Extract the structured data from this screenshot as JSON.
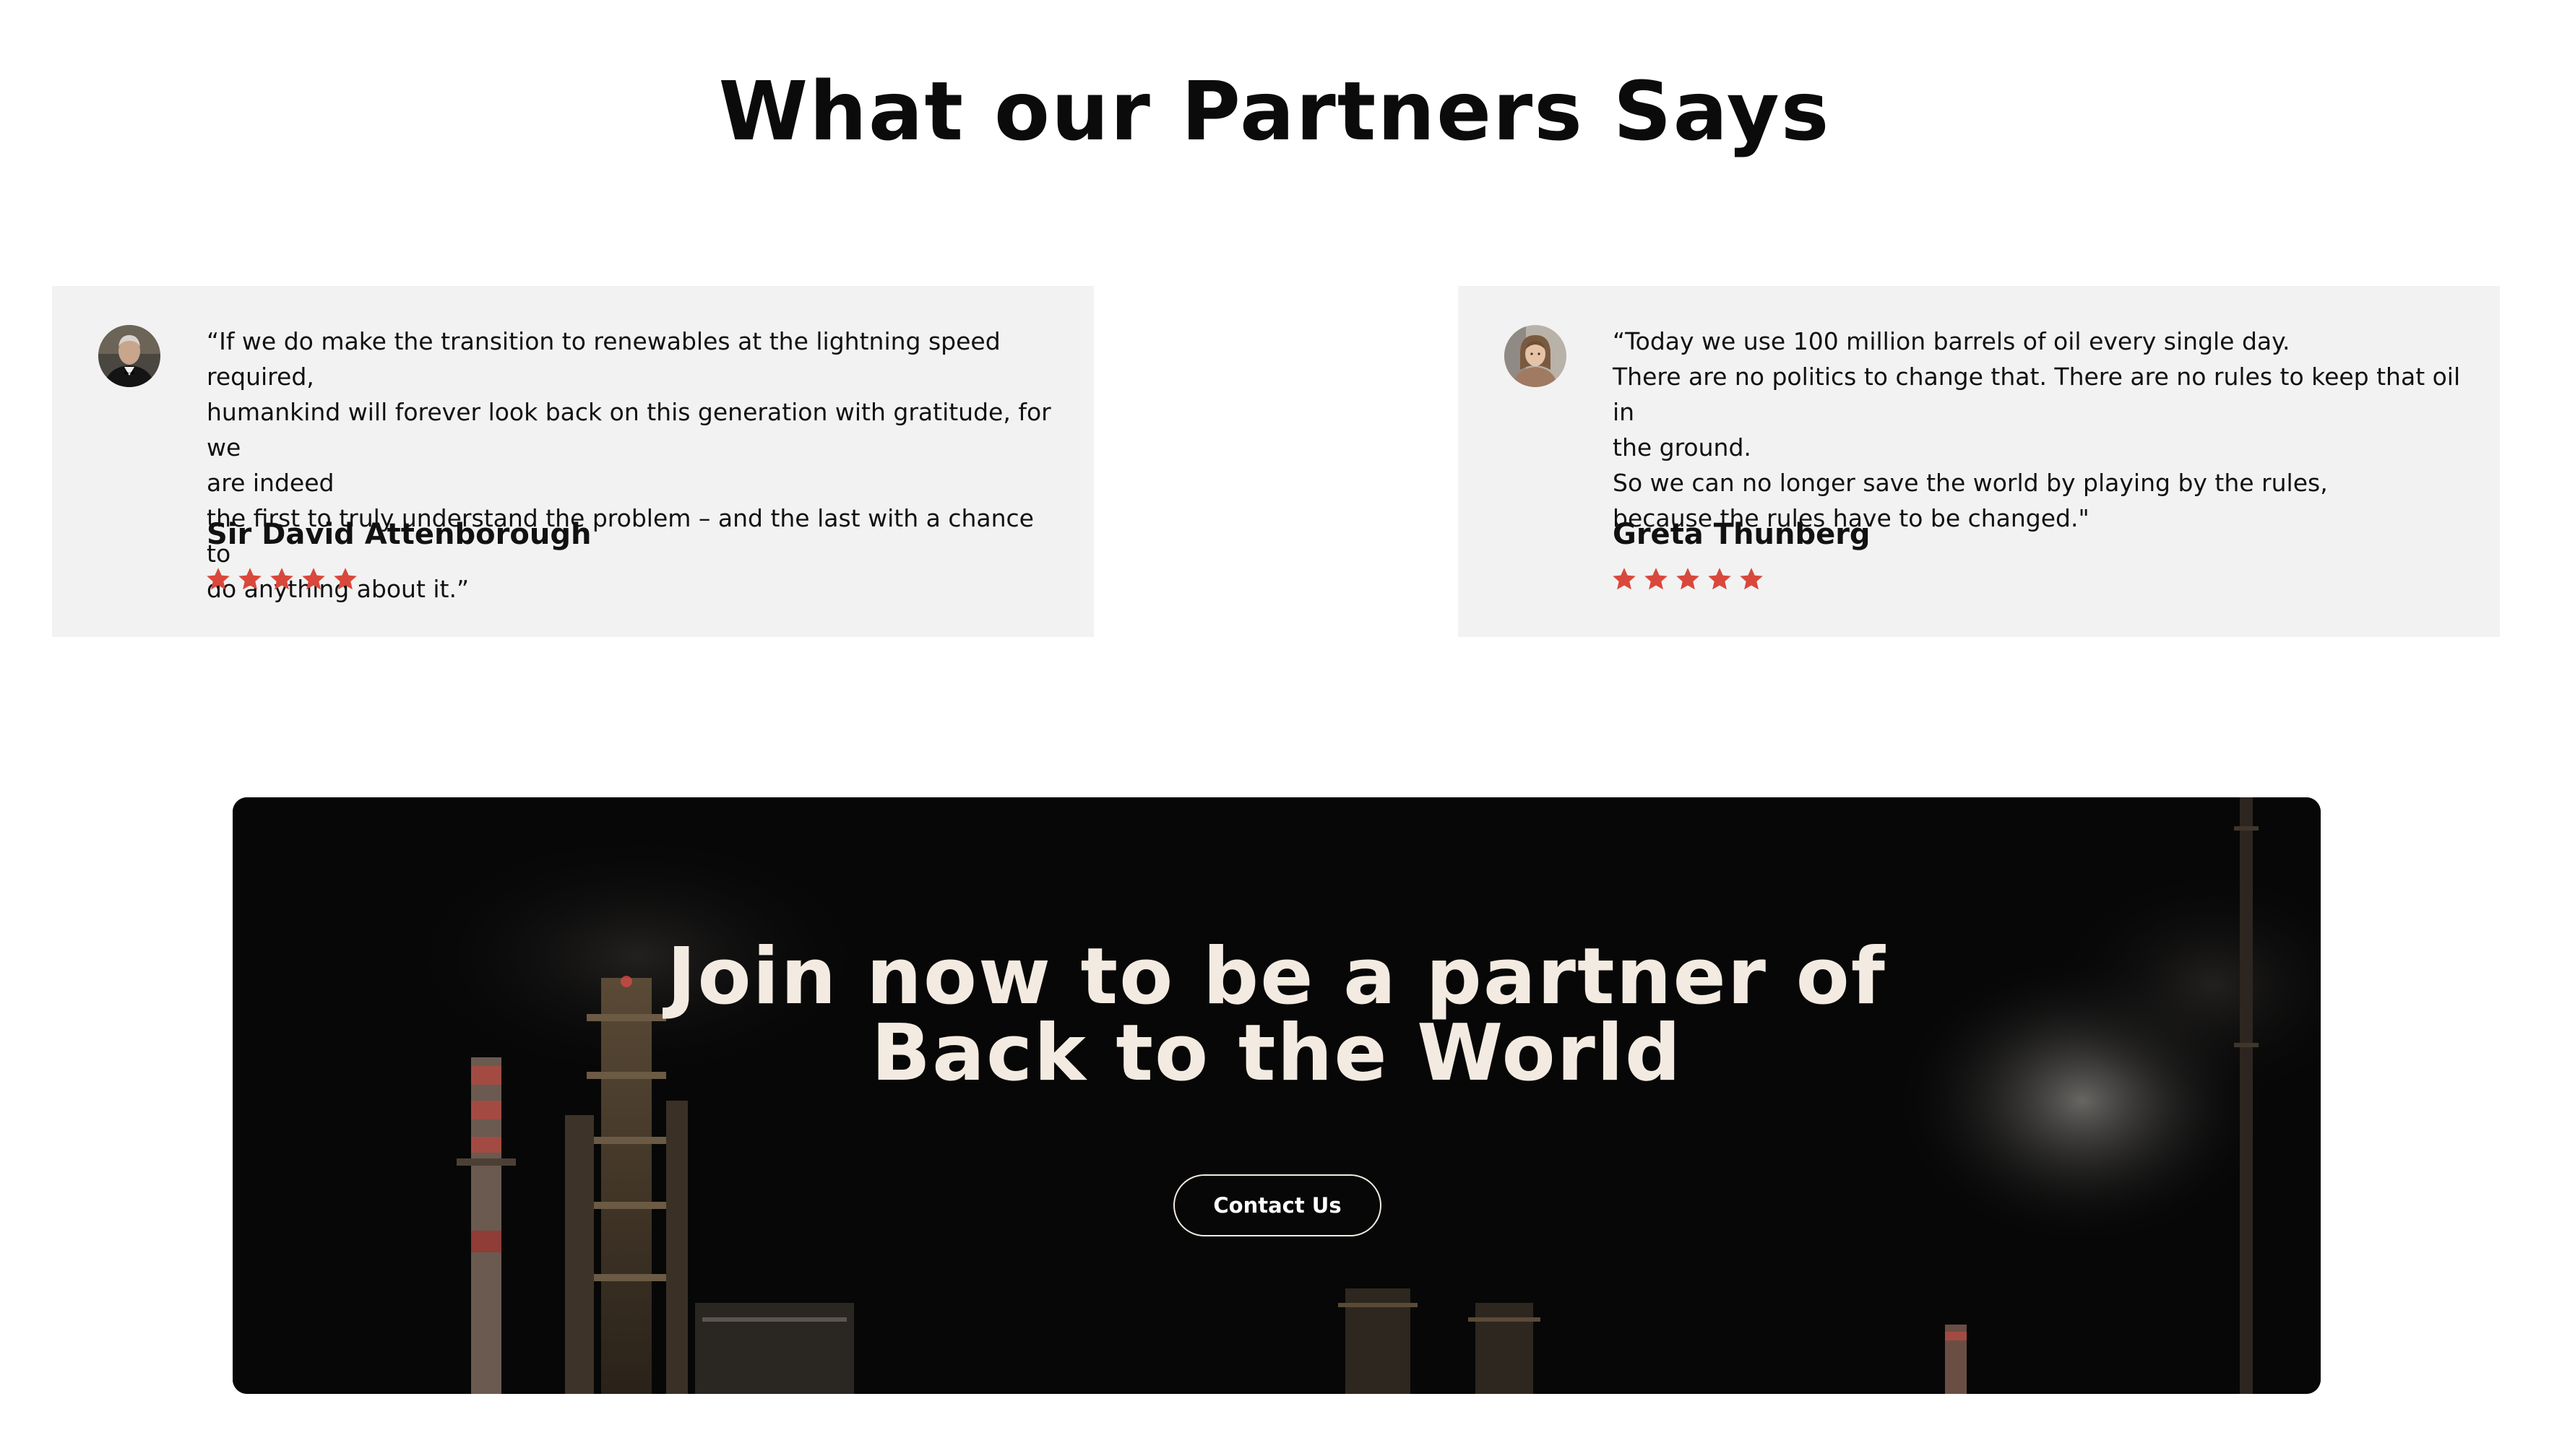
{
  "testimonials_section": {
    "title": "What our Partners Says",
    "testimonials": [
      {
        "quote_lines": [
          "“If we do make the transition to renewables at the lightning speed required,",
          "humankind will forever look back on this generation with gratitude, for we",
          "are indeed",
          "the first to truly understand the problem – and the last with a chance to",
          "do anything about it.”"
        ],
        "author": "Sir David Attenborough",
        "rating": 5,
        "avatar_icon": "man-portrait-avatar"
      },
      {
        "quote_lines": [
          "“Today we use 100 million barrels of oil every single day.",
          "There are no politics to change that. There are no rules to keep that oil in",
          "the ground.",
          "So we can no longer save the world by playing by the rules,",
          "because the rules have to be changed.\""
        ],
        "author": "Greta Thunberg",
        "rating": 5,
        "avatar_icon": "woman-portrait-avatar"
      }
    ]
  },
  "cta": {
    "title_lines": [
      "Join now to be a partner of",
      "Back to the World"
    ],
    "button_label": "Contact Us",
    "background_image": "refinery-at-night-photo"
  },
  "colors": {
    "star": "#d9483b",
    "card_bg": "#f2f2f2",
    "cta_text": "#f3ebe1",
    "cta_bg": "#060606"
  }
}
